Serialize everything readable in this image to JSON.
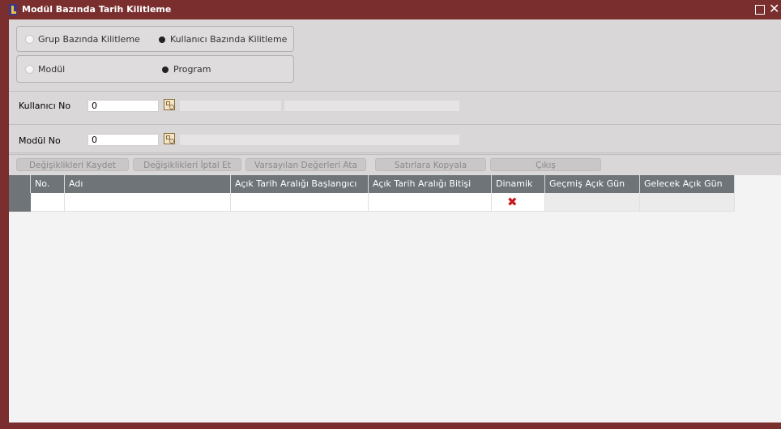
{
  "window": {
    "title": "Modül Bazında Tarih Kilitleme"
  },
  "radio_groups": {
    "group1": {
      "option1": "Grup Bazında Kilitleme",
      "option2": "Kullanıcı Bazında Kilitleme",
      "selected": "option2"
    },
    "group2": {
      "option1": "Modül",
      "option2": "Program",
      "selected": "option2"
    }
  },
  "fields": {
    "kullanici_no": {
      "label": "Kullanıcı No",
      "value": "0"
    },
    "modul_no": {
      "label": "Modül No",
      "value": "0"
    }
  },
  "toolbar": {
    "save": "Değişiklikleri Kaydet",
    "cancel": "Değişiklikleri İptal Et",
    "defaults": "Varsayılan Değerleri Ata",
    "copy": "Satırlara Kopyala",
    "exit": "Çıkış"
  },
  "table": {
    "columns": [
      "No.",
      "Adı",
      "Açık Tarih Aralığı Başlangıcı",
      "Açık Tarih Aralığı Bitişi",
      "Dinamik",
      "Geçmiş Açık Gün",
      "Gelecek Açık Gün"
    ],
    "rows": [
      {
        "no": "",
        "adi": "",
        "baslangic": "",
        "bitis": "",
        "dinamik": "x-icon",
        "gecmis": "",
        "gelecek": ""
      }
    ]
  },
  "colors": {
    "titlebar": "#7a2e2e",
    "header": "#6e7478",
    "dinamik_x": "#c8161c"
  }
}
